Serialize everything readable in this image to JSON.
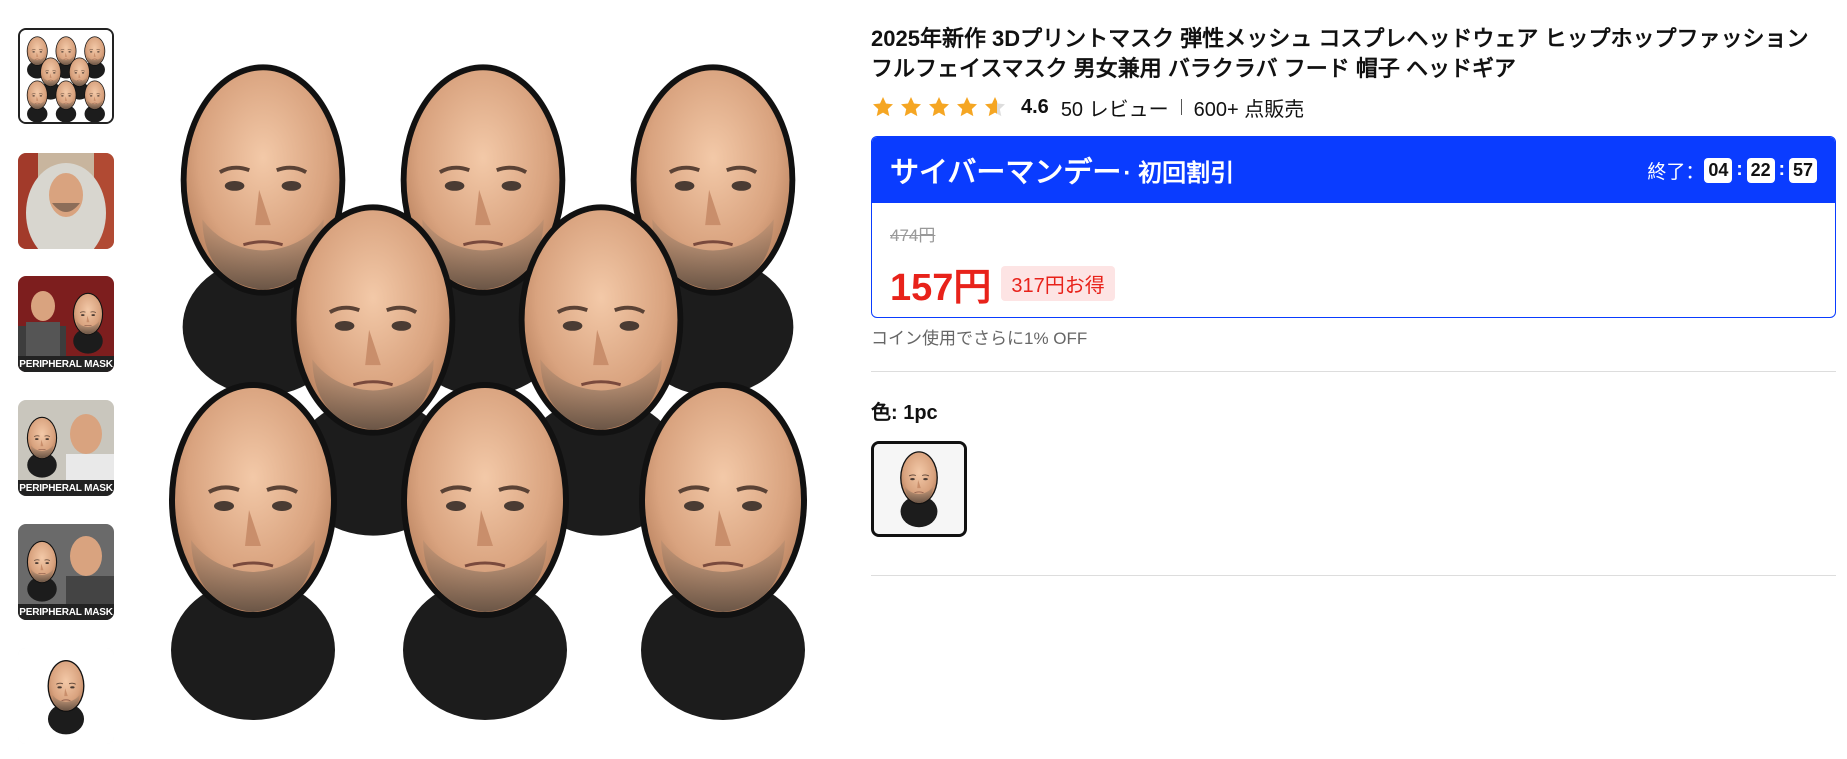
{
  "product": {
    "title": "2025年新作 3Dプリントマスク 弾性メッシュ コスプレヘッドウェア ヒップホップファッション フルフェイスマスク 男女兼用 バラクラバ フード 帽子 ヘッドギア",
    "rating": "4.6",
    "stars": 4.6,
    "reviews": "50 レビュー",
    "sold": "600+ 点販売"
  },
  "deal": {
    "name": "サイバーマンデー",
    "subtitle": "· 初回割引",
    "ends_label": "終了：",
    "hours": "04",
    "minutes": "22",
    "seconds": "57",
    "original_price": "474円",
    "price": "157円",
    "savings": "317円お得",
    "accent_color": "#0a3cff",
    "price_color": "#e8221a"
  },
  "coin_note": "コイン使用でさらに1% OFF",
  "variant": {
    "label": "色: 1pc"
  },
  "thumbnails": [
    {
      "icon": "grid-of-masks-thumbnail",
      "caption": ""
    },
    {
      "icon": "hooded-person-thumbnail",
      "caption": ""
    },
    {
      "icon": "mask-comparison-thumbnail",
      "caption": "PERIPHERAL MASK"
    },
    {
      "icon": "mask-comparison-thumbnail",
      "caption": "PERIPHERAL MASK"
    },
    {
      "icon": "mask-comparison-thumbnail",
      "caption": "PERIPHERAL MASK"
    },
    {
      "icon": "single-mask-thumbnail",
      "caption": ""
    }
  ]
}
